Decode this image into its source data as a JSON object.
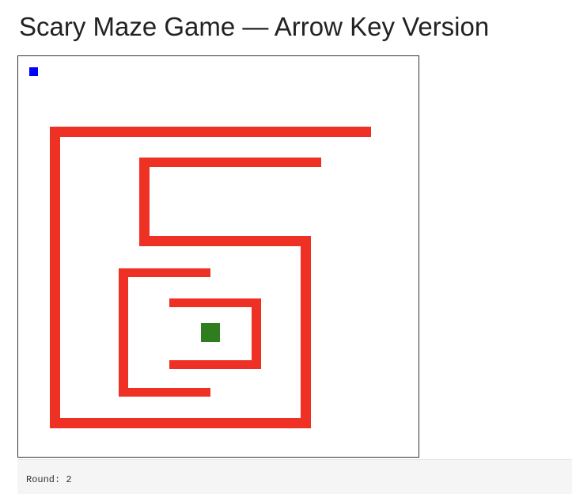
{
  "page": {
    "title": "Scary Maze Game — Arrow Key Version"
  },
  "game": {
    "colors": {
      "wall": "#ee3124",
      "player": "#0000ff",
      "goal": "#2e7d1f",
      "background": "#ffffff",
      "border": "#333333"
    },
    "player_icon": "blue-square",
    "goal_icon": "green-square"
  },
  "status": {
    "round_label": "Round:",
    "round_value": "2"
  }
}
